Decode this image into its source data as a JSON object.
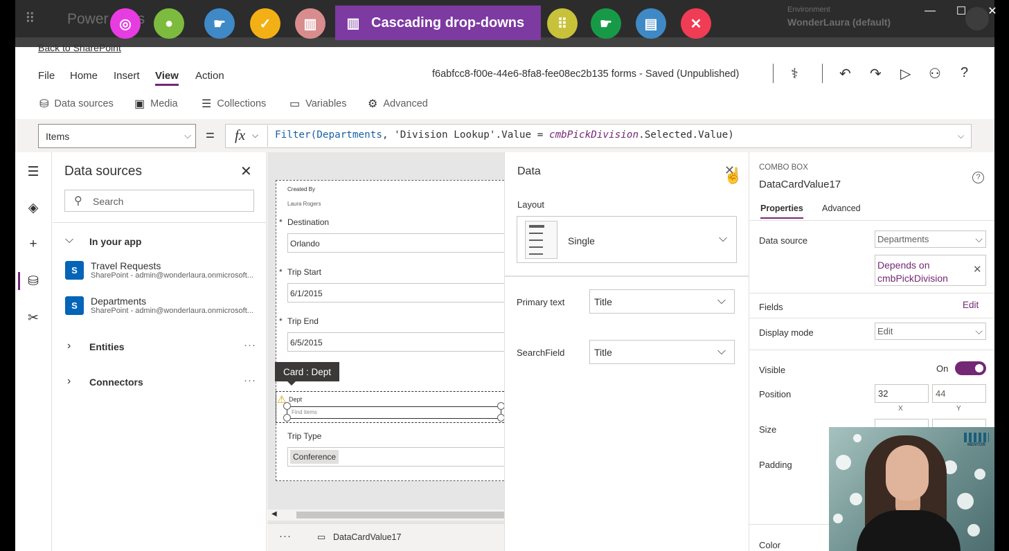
{
  "app": {
    "title": "Power Apps",
    "environment_label": "Environment",
    "environment_value": "WonderLaura (default)",
    "back_link": "Back to SharePoint"
  },
  "video_toolbar": {
    "title": "Cascading drop-downs",
    "buttons": [
      {
        "icon": "compass-icon",
        "color": "#e83ce3"
      },
      {
        "icon": "person-icon",
        "color": "#7dbb3f"
      },
      {
        "icon": "pointing-hand-icon",
        "color": "#3f89c6"
      },
      {
        "icon": "checkmark-icon",
        "color": "#f3b015"
      },
      {
        "icon": "building-icon",
        "color": "#d98c8d"
      },
      {
        "icon": "braille-icon",
        "color": "#c8c23a"
      },
      {
        "icon": "pointing-hand-icon",
        "color": "#179a47"
      },
      {
        "icon": "document-icon",
        "color": "#3f89c6"
      },
      {
        "icon": "tools-icon",
        "color": "#f03c55"
      }
    ]
  },
  "menu": {
    "items": [
      "File",
      "Home",
      "Insert",
      "View",
      "Action"
    ],
    "status": "f6abfcc8-f00e-44e6-8fa8-fee08ec2b135 forms - Saved (Unpublished)"
  },
  "submenu": {
    "items": [
      "Data sources",
      "Media",
      "Collections",
      "Variables",
      "Advanced"
    ]
  },
  "formula_bar": {
    "property": "Items",
    "equals": "=",
    "fx": "fx",
    "formula_fn": "Filter(",
    "formula_table": "Departments",
    "formula_mid": ", 'Division Lookup'.Value = ",
    "formula_control": "cmbPickDivision",
    "formula_end": ".Selected.Value)"
  },
  "data_sources": {
    "title": "Data sources",
    "search_placeholder": "Search",
    "in_your_app": "In your app",
    "items": [
      {
        "name": "Travel Requests",
        "sub": "SharePoint - admin@wonderlaura.onmicrosoft..."
      },
      {
        "name": "Departments",
        "sub": "SharePoint - admin@wonderlaura.onmicrosoft..."
      }
    ],
    "entities": "Entities",
    "connectors": "Connectors",
    "more": "···"
  },
  "form": {
    "created_by_label": "Created By",
    "created_by_value": "Laura Rogers",
    "destination_label": "Destination",
    "destination_value": "Orlando",
    "trip_start_label": "Trip Start",
    "trip_start_value": "6/1/2015",
    "trip_end_label": "Trip End",
    "trip_end_value": "6/5/2015",
    "card_tooltip": "Card : Dept",
    "dept_label": "Dept",
    "dept_placeholder": "Find items",
    "trip_type_label": "Trip Type",
    "trip_type_value": "Conference",
    "required_mark": "*"
  },
  "bottom_bar": {
    "more": "···",
    "control_name": "DataCardValue17"
  },
  "data_pane": {
    "title": "Data",
    "layout_label": "Layout",
    "layout_value": "Single",
    "primary_text_label": "Primary text",
    "primary_text_value": "Title",
    "search_field_label": "SearchField",
    "search_field_value": "Title"
  },
  "properties": {
    "control_type": "COMBO BOX",
    "control_name": "DataCardValue17",
    "tab_properties": "Properties",
    "tab_advanced": "Advanced",
    "data_source_label": "Data source",
    "data_source_value": "Departments",
    "depends_on_line1": "Depends on",
    "depends_on_line2": "cmbPickDivision",
    "fields_label": "Fields",
    "fields_edit": "Edit",
    "display_mode_label": "Display mode",
    "display_mode_value": "Edit",
    "visible_label": "Visible",
    "visible_state": "On",
    "position_label": "Position",
    "position_x": "32",
    "position_y": "44",
    "x_label": "X",
    "y_label": "Y",
    "size_label": "Size",
    "padding_label": "Padding",
    "color_label": "Color"
  },
  "webcam": {
    "logo_text": "MENTOR"
  }
}
